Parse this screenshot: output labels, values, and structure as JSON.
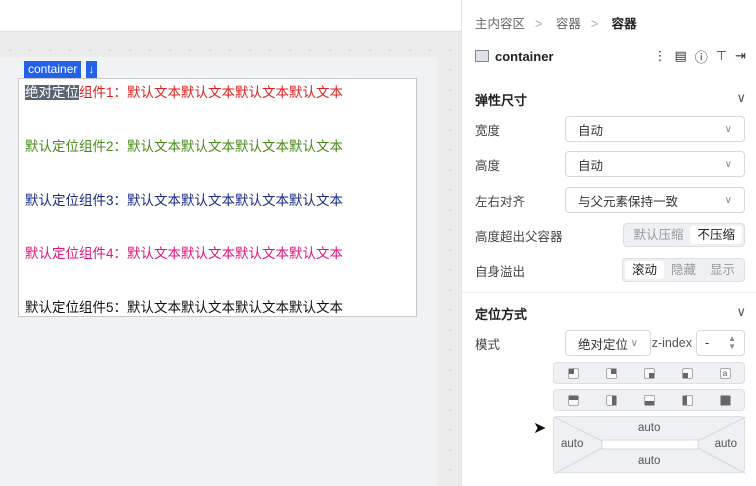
{
  "canvas": {
    "tag_label": "container",
    "tag_arrow": "↓",
    "lines": [
      {
        "selected": "绝对定位",
        "rest": "组件1：默认文本默认文本默认文本默认文本",
        "color": "#e02020"
      },
      {
        "text": "默认定位组件2：默认文本默认文本默认文本默认文本",
        "color": "#4a8a1c"
      },
      {
        "text": "默认定位组件3：默认文本默认文本默认文本默认文本",
        "color": "#1a2a8a"
      },
      {
        "text": "默认定位组件4：默认文本默认文本默认文本默认文本",
        "color": "#e0157a"
      },
      {
        "text": "默认定位组件5：默认文本默认文本默认文本默认文本",
        "color": "#111111"
      }
    ]
  },
  "panel": {
    "breadcrumb": [
      "主内容区",
      "容器",
      "容器"
    ],
    "component_name": "container",
    "flex_section": "弹性尺寸",
    "width_label": "宽度",
    "width_value": "自动",
    "height_label": "高度",
    "height_value": "自动",
    "align_label": "左右对齐",
    "align_value": "与父元素保持一致",
    "overflow_parent_label": "高度超出父容器",
    "overflow_parent_options": [
      "默认压缩",
      "不压缩"
    ],
    "self_overflow_label": "自身溢出",
    "self_overflow_options": [
      "滚动",
      "隐藏",
      "显示"
    ],
    "position_section": "定位方式",
    "mode_label": "模式",
    "mode_value": "绝对定位",
    "zindex_label": "z-index",
    "zindex_value": "-",
    "offsets": {
      "top": "auto",
      "left": "auto",
      "right": "auto",
      "bottom": "auto"
    }
  }
}
